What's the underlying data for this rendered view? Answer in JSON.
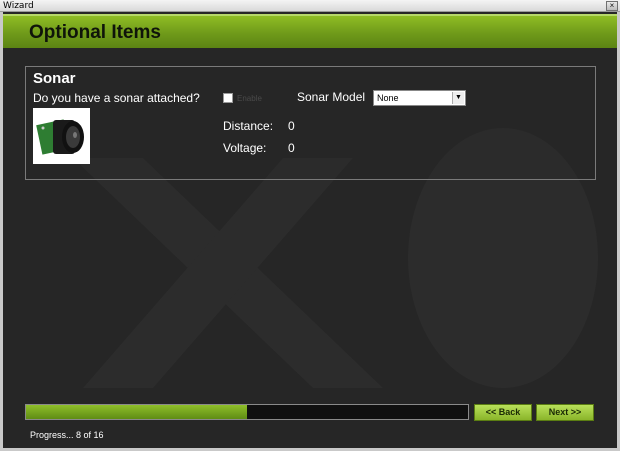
{
  "window": {
    "title": "Wizard",
    "close_glyph": "×"
  },
  "header": {
    "title": "Optional Items"
  },
  "sonar": {
    "title": "Sonar",
    "question": "Do you have a sonar attached?",
    "enable_label": "Enable",
    "enable_checked": false,
    "model_label": "Sonar Model",
    "model_value": "None",
    "distance_label": "Distance:",
    "distance_value": "0",
    "voltage_label": "Voltage:",
    "voltage_value": "0"
  },
  "progress": {
    "fraction": 0.5,
    "text": "Progress... 8 of 16"
  },
  "buttons": {
    "back": "<< Back",
    "next": "Next >>"
  },
  "colors": {
    "accent": "#7aa51e",
    "background": "#262626"
  }
}
